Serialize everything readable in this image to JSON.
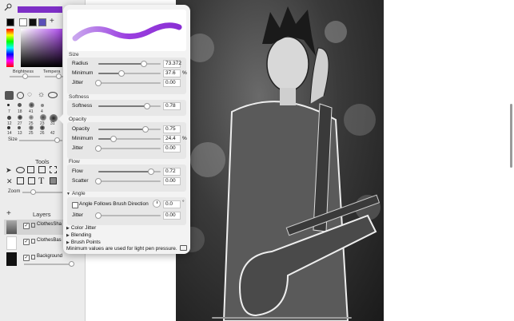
{
  "colors": {
    "accent_purple": "#7d2fc6",
    "stroke_purple": "#9b3fe0",
    "panel_bg": "#ececec",
    "popover_bg": "#f3f3f3"
  },
  "left_panel": {
    "brightness_label": "Brightness",
    "temperature_label": "Tempera",
    "size_label": "Size",
    "tools_label": "Tools",
    "zoom_label": "Zoom",
    "layers_label": "Layers",
    "add_label": "+",
    "brush_sizes": [
      "7",
      "18",
      "41",
      "4",
      "12",
      "27",
      "25",
      "23",
      "31",
      "14",
      "13",
      "25",
      "26",
      "42"
    ],
    "layers": [
      {
        "name": "ClothesSha"
      },
      {
        "name": "ClothesBas"
      },
      {
        "name": "Background"
      }
    ]
  },
  "popover": {
    "size": {
      "title": "Size",
      "radius_label": "Radius",
      "radius_value": "73.372",
      "minimum_label": "Minimum",
      "minimum_value": "37.6",
      "minimum_unit": "%",
      "jitter_label": "Jitter",
      "jitter_value": "0.00"
    },
    "softness": {
      "title": "Softness",
      "softness_label": "Softness",
      "softness_value": "0.78"
    },
    "opacity": {
      "title": "Opacity",
      "opacity_label": "Opacity",
      "opacity_value": "0.75",
      "minimum_label": "Minimum",
      "minimum_value": "24.4",
      "minimum_unit": "%",
      "jitter_label": "Jitter",
      "jitter_value": "0.00"
    },
    "flow": {
      "title": "Flow",
      "flow_label": "Flow",
      "flow_value": "0.72",
      "scatter_label": "Scatter",
      "scatter_value": "0.00"
    },
    "angle": {
      "title": "Angle",
      "follows_label": "Angle Follows Brush Direction",
      "angle_value": "0.0",
      "degree": "°",
      "jitter_label": "Jitter",
      "jitter_value": "0.00"
    },
    "collapsed": {
      "color_jitter": "Color Jitter",
      "blending": "Blending",
      "brush_points": "Brush Points"
    },
    "footer_text": "Minimum values are used for light pen pressure."
  },
  "levels": {
    "radius": 0.73,
    "size_minimum": 0.376,
    "size_jitter": 0.0,
    "softness": 0.78,
    "opacity": 0.75,
    "opacity_minimum": 0.244,
    "opacity_jitter": 0.0,
    "flow": 0.85,
    "scatter": 0.0,
    "angle_jitter": 0.0
  }
}
